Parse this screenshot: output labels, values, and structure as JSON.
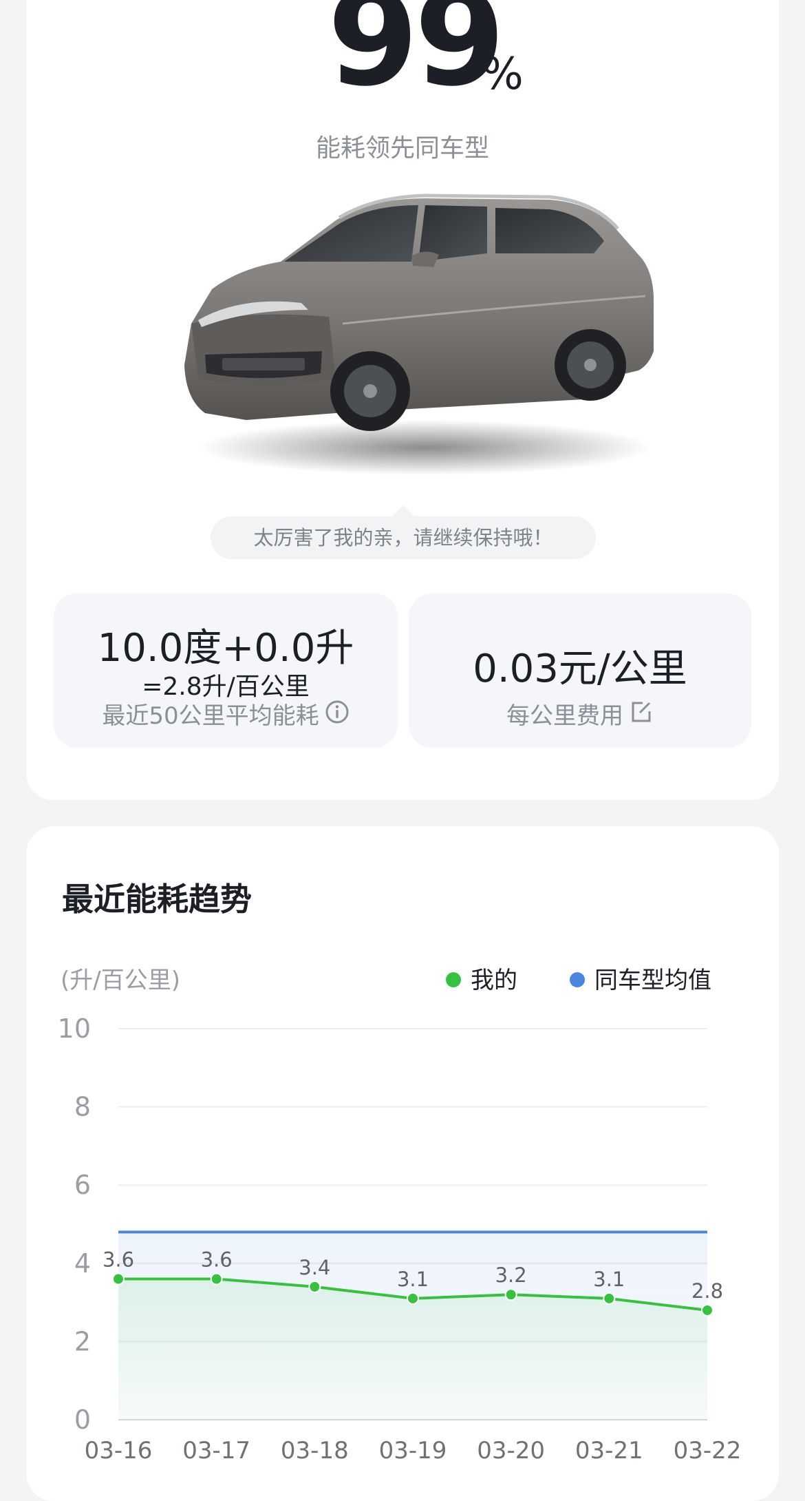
{
  "summary": {
    "percent_value": "99",
    "percent_sign": "%",
    "caption": "能耗领先同车型",
    "bubble_text": "太厉害了我的亲，请继续保持哦！"
  },
  "stats": {
    "energy_main": "10.0度+0.0升",
    "energy_sub": "=2.8升/百公里",
    "energy_label": "最近50公里平均能耗",
    "cost_main": "0.03元/公里",
    "cost_label": "每公里费用"
  },
  "trend": {
    "title": "最近能耗趋势",
    "unit": "(升/百公里)",
    "legend_mine": "我的",
    "legend_avg": "同车型均值"
  },
  "colors": {
    "mine": "#36c23f",
    "avg": "#4a86e0",
    "text_dark": "#1c1f26",
    "text_gray": "#8b8f96"
  },
  "icons": {
    "info": "info-circle-icon",
    "edit": "edit-icon"
  },
  "chart_data": {
    "type": "line",
    "categories": [
      "03-16",
      "03-17",
      "03-18",
      "03-19",
      "03-20",
      "03-21",
      "03-22"
    ],
    "ylim": [
      0,
      10
    ],
    "yticks": [
      0,
      2,
      4,
      6,
      8,
      10
    ],
    "grid": true,
    "legend_position": "top-right",
    "series": [
      {
        "name": "我的",
        "values": [
          3.6,
          3.6,
          3.4,
          3.1,
          3.2,
          3.1,
          2.8
        ],
        "color": "#36c23f",
        "labels": true
      },
      {
        "name": "同车型均值",
        "values": [
          4.8,
          4.8,
          4.8,
          4.8,
          4.8,
          4.8,
          4.8
        ],
        "color": "#4a86e0",
        "labels": false
      }
    ]
  }
}
